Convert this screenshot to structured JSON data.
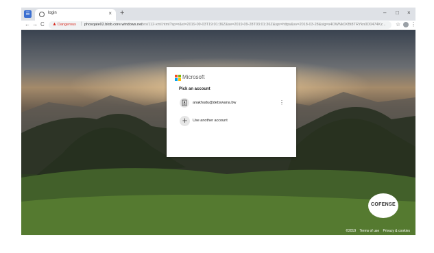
{
  "browser": {
    "app_badge": "☰",
    "tab_title": "login",
    "tab_close": "×",
    "new_tab": "+",
    "window_controls": [
      "–",
      "□",
      "×"
    ],
    "nav": [
      "←",
      "→",
      "C"
    ],
    "warning_icon": "▲",
    "security_label": "Dangerous",
    "separator": "|",
    "url_host": "phosqate02.blob.core.windows.net",
    "url_path": "/vrs/112-xml.html?sp=r&st=2019-09-03T19:01:36Z&se=2019-09-28T03:01:36Z&spr=https&sv=2018-03-28&sig=s4OWNk0XBt8TRYkn0D0474Kz...",
    "star_icon": "☆",
    "menu_icon": "⋮"
  },
  "login": {
    "brand": "Microsoft",
    "heading": "Pick an account",
    "account_email": "anakhudu@debswana.bw",
    "account_more": "⋮",
    "add_icon": "+",
    "add_label": "Use another account"
  },
  "footer": {
    "copyright": "©2019",
    "terms": "Terms of use",
    "privacy": "Privacy & cookies"
  },
  "watermark": {
    "label": "COFENSE"
  },
  "colors": {
    "danger": "#d93025",
    "ms_red": "#f25022",
    "ms_green": "#7fba00",
    "ms_blue": "#00a4ef",
    "ms_yellow": "#ffb900"
  }
}
